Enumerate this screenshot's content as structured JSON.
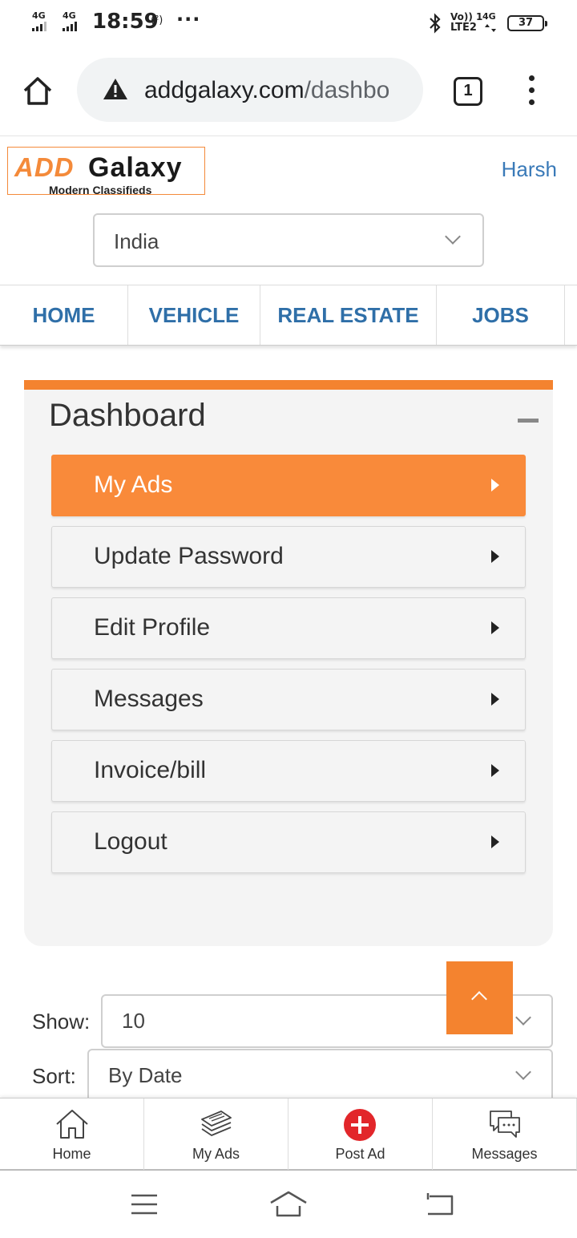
{
  "status_bar": {
    "net1": "4G",
    "net2": "4G",
    "time": "18:59",
    "hotspot": "(²)",
    "more": "···",
    "volte_line1": "Vo)) 1",
    "volte_line2": "LTE2",
    "net3": "4G",
    "battery": "37"
  },
  "browser": {
    "url_host": "addgalaxy.com",
    "url_path": "/dashbo",
    "tab_count": "1"
  },
  "header": {
    "logo_add": "ADD",
    "logo_galaxy": "Galaxy",
    "logo_tagline": "Modern Classifieds",
    "user_name": "Harsh",
    "country_selected": "India"
  },
  "nav": {
    "items": [
      {
        "label": "HOME"
      },
      {
        "label": "VEHICLE"
      },
      {
        "label": "REAL ESTATE"
      },
      {
        "label": "JOBS"
      }
    ]
  },
  "dashboard": {
    "title": "Dashboard",
    "menu": [
      {
        "label": "My Ads",
        "active": true
      },
      {
        "label": "Update Password",
        "active": false
      },
      {
        "label": "Edit Profile",
        "active": false
      },
      {
        "label": "Messages",
        "active": false
      },
      {
        "label": "Invoice/bill",
        "active": false
      },
      {
        "label": "Logout",
        "active": false
      }
    ]
  },
  "filters": {
    "show_label": "Show:",
    "show_value": "10",
    "sort_label": "Sort:",
    "sort_value": "By Date"
  },
  "bottom_tabs": [
    {
      "label": "Home",
      "icon": "home-icon"
    },
    {
      "label": "My Ads",
      "icon": "ads-stack-icon"
    },
    {
      "label": "Post Ad",
      "icon": "plus-circle-icon"
    },
    {
      "label": "Messages",
      "icon": "chat-icon"
    }
  ],
  "colors": {
    "accent": "#f4832f",
    "link": "#2f6fa8",
    "post_ad": "#e2262a"
  }
}
